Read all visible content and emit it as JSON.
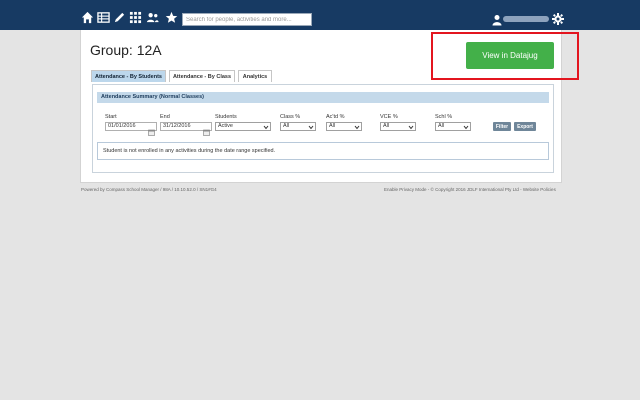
{
  "topbar": {
    "nav_icons": [
      "home-icon",
      "grid-list-icon",
      "pencil-icon",
      "apps-icon",
      "people-icon",
      "star-icon"
    ],
    "search_placeholder": "Search for people, activities and more...",
    "user_icon": "user-icon",
    "settings_icon": "gear-icon",
    "bar_color": "#173a63"
  },
  "page": {
    "title": "Group: 12A",
    "datajug_button": "View in Datajug",
    "accent_green": "#43b049",
    "highlight_color": "#e3151f"
  },
  "tabs": [
    {
      "label": "Attendance - By Students",
      "active": true
    },
    {
      "label": "Attendance - By Class",
      "active": false
    },
    {
      "label": "Analytics",
      "active": false
    }
  ],
  "summary": {
    "header": "Attendance Summary (Normal Classes)",
    "filters": {
      "start_label": "Start",
      "start_value": "01/01/2016",
      "end_label": "End",
      "end_value": "31/12/2016",
      "students_label": "Students",
      "students_value": "Active",
      "class_label": "Class %",
      "class_value": "All",
      "actd_label": "Ac'td %",
      "actd_value": "All",
      "vce_label": "VCE %",
      "vce_value": "All",
      "schl_label": "Schl %",
      "schl_value": "All",
      "filter_button": "Filter",
      "export_button": "Export"
    },
    "notice": "Student is not enrolled in any activities during the date range specified."
  },
  "footer": {
    "left": "Powered by Compass School Manager / 98A / 10.10.52.0 / SN1#G4",
    "right": "Enable Privacy Mode - © Copyright 2016 JDLF International Pty Ltd - Website Policies"
  }
}
